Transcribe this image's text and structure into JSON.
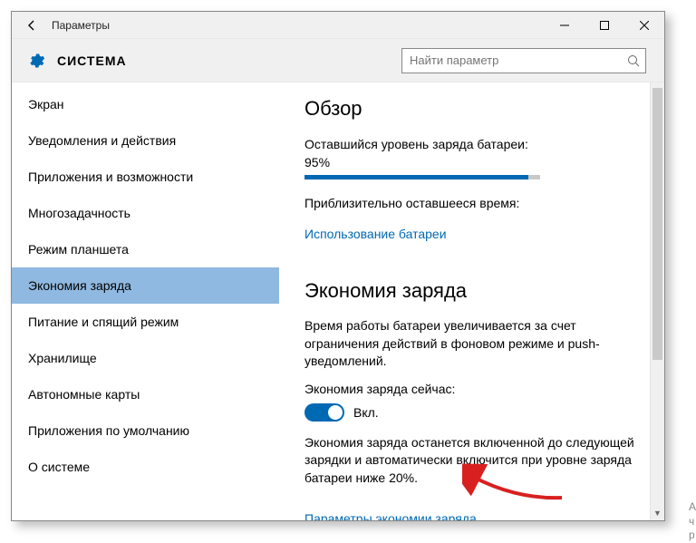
{
  "window": {
    "title": "Параметры"
  },
  "header": {
    "section_title": "СИСТЕМА",
    "search_placeholder": "Найти параметр"
  },
  "sidebar": {
    "items": [
      {
        "label": "Экран",
        "selected": false
      },
      {
        "label": "Уведомления и действия",
        "selected": false
      },
      {
        "label": "Приложения и возможности",
        "selected": false
      },
      {
        "label": "Многозадачность",
        "selected": false
      },
      {
        "label": "Режим планшета",
        "selected": false
      },
      {
        "label": "Экономия заряда",
        "selected": true
      },
      {
        "label": "Питание и спящий режим",
        "selected": false
      },
      {
        "label": "Хранилище",
        "selected": false
      },
      {
        "label": "Автономные карты",
        "selected": false
      },
      {
        "label": "Приложения по умолчанию",
        "selected": false
      },
      {
        "label": "О системе",
        "selected": false
      }
    ]
  },
  "main": {
    "overview_heading": "Обзор",
    "battery_remaining_label": "Оставшийся уровень заряда батареи:",
    "battery_remaining_value": "95%",
    "battery_percent": 95,
    "time_remaining_label": "Приблизительно оставшееся время:",
    "usage_link": "Использование батареи",
    "saver_heading": "Экономия заряда",
    "saver_description": "Время работы батареи увеличивается за счет ограничения действий в фоновом режиме и push-уведомлений.",
    "saver_now_label": "Экономия заряда сейчас:",
    "toggle_state_label": "Вкл.",
    "toggle_on": true,
    "saver_note": "Экономия заряда останется включенной до следующей зарядки и автоматически включится при уровне заряда батареи ниже 20%.",
    "saver_settings_link": "Параметры экономии заряда"
  },
  "colors": {
    "accent": "#0069b3",
    "sidebar_selected": "#8fb9e0"
  }
}
